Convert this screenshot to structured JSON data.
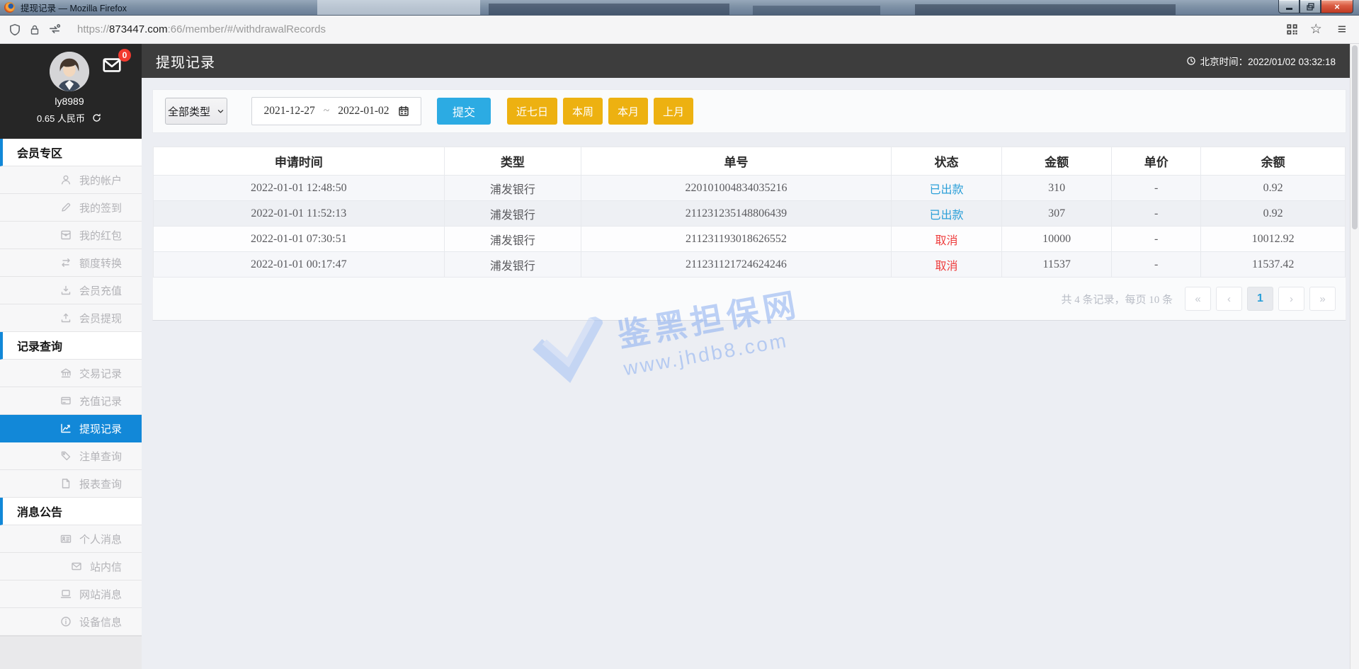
{
  "browser": {
    "window_title": "提现记录 — Mozilla Firefox",
    "url": {
      "prefix": "https://",
      "domain": "873447.com",
      "rest": ":66/member/#/withdrawalRecords"
    },
    "window_buttons": {
      "minimize": "minimize",
      "restore": "restore",
      "close": "×"
    },
    "star_glyph": "☆",
    "menu_glyph": "≡"
  },
  "header": {
    "title": "提现记录",
    "beijing_time": "北京时间：2022/01/02 03:32:18"
  },
  "user": {
    "username": "ly8989",
    "balance": "0.65 人民币",
    "mail_badge": "0"
  },
  "sidebar": {
    "sections": [
      {
        "title": "会员专区",
        "items": [
          {
            "icon": "user-icon",
            "label": "我的帐户"
          },
          {
            "icon": "pencil-icon",
            "label": "我的签到"
          },
          {
            "icon": "redpacket-icon",
            "label": "我的红包"
          },
          {
            "icon": "transfer-icon",
            "label": "额度转换"
          },
          {
            "icon": "deposit-icon",
            "label": "会员充值"
          },
          {
            "icon": "withdraw-icon",
            "label": "会员提现"
          }
        ]
      },
      {
        "title": "记录查询",
        "items": [
          {
            "icon": "bank-icon",
            "label": "交易记录"
          },
          {
            "icon": "card-icon",
            "label": "充值记录"
          },
          {
            "icon": "chart-icon",
            "label": "提现记录",
            "active": true
          },
          {
            "icon": "tags-icon",
            "label": "注单查询"
          },
          {
            "icon": "report-icon",
            "label": "报表查询"
          }
        ]
      },
      {
        "title": "消息公告",
        "items": [
          {
            "icon": "idcard-icon",
            "label": "个人消息"
          },
          {
            "icon": "mail-icon",
            "label": "站内信"
          },
          {
            "icon": "monitor-icon",
            "label": "网站消息"
          },
          {
            "icon": "info-icon",
            "label": "设备信息"
          }
        ]
      }
    ]
  },
  "filters": {
    "type_select_value": "全部类型",
    "date_from": "2021-12-27",
    "date_separator": "~",
    "date_to": "2022-01-02",
    "submit_label": "提交",
    "quick_buttons": [
      "近七日",
      "本周",
      "本月",
      "上月"
    ]
  },
  "table": {
    "columns": [
      "申请时间",
      "类型",
      "单号",
      "状态",
      "金额",
      "单价",
      "余额"
    ],
    "rows": [
      {
        "time": "2022-01-01 12:48:50",
        "type": "浦发银行",
        "order_no": "220101004834035216",
        "status": "已出款",
        "status_type": "paid",
        "amount": "310",
        "unit_price": "-",
        "balance": "0.92"
      },
      {
        "time": "2022-01-01 11:52:13",
        "type": "浦发银行",
        "order_no": "211231235148806439",
        "status": "已出款",
        "status_type": "paid",
        "amount": "307",
        "unit_price": "-",
        "balance": "0.92"
      },
      {
        "time": "2022-01-01 07:30:51",
        "type": "浦发银行",
        "order_no": "211231193018626552",
        "status": "取消",
        "status_type": "cancelled",
        "amount": "10000",
        "unit_price": "-",
        "balance": "10012.92"
      },
      {
        "time": "2022-01-01 00:17:47",
        "type": "浦发银行",
        "order_no": "211231121724624246",
        "status": "取消",
        "status_type": "cancelled",
        "amount": "11537",
        "unit_price": "-",
        "balance": "11537.42"
      }
    ]
  },
  "pagination": {
    "summary": "共 4 条记录，每页 10 条",
    "buttons": [
      {
        "label": "«",
        "type": "first",
        "active": false
      },
      {
        "label": "‹",
        "type": "prev",
        "active": false
      },
      {
        "label": "1",
        "type": "page-1",
        "active": true
      },
      {
        "label": "›",
        "type": "next",
        "active": false
      },
      {
        "label": "»",
        "type": "last",
        "active": false
      }
    ]
  },
  "watermark": {
    "title": "鉴黑担保网",
    "url": "www.jhdb8.com"
  },
  "colors": {
    "accent_blue": "#1288d8",
    "submit_blue": "#2cabe3",
    "quick_yellow": "#edb111",
    "status_paid": "#2b9fd8",
    "status_cancelled": "#ee3b3b"
  }
}
